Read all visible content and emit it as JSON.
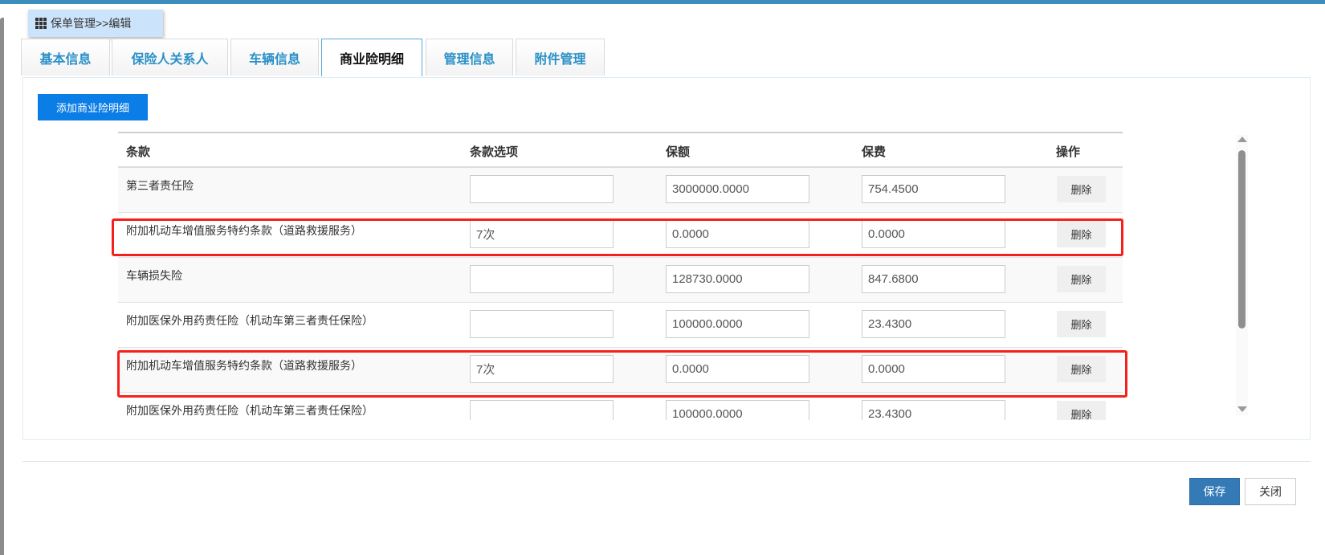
{
  "breadcrumb": {
    "icon": "grid-icon",
    "text": "保单管理>>编辑"
  },
  "tabs": [
    {
      "label": "基本信息"
    },
    {
      "label": "保险人关系人"
    },
    {
      "label": "车辆信息"
    },
    {
      "label": "商业险明细",
      "active": true
    },
    {
      "label": "管理信息"
    },
    {
      "label": "附件管理"
    }
  ],
  "add_button": "添加商业险明细",
  "table": {
    "headers": [
      "条款",
      "条款选项",
      "保额",
      "保费",
      "操作"
    ],
    "rows": [
      {
        "name": "第三者责任险",
        "option": "",
        "amount": "3000000.0000",
        "premium": "754.4500",
        "action": "删除",
        "highlighted": false
      },
      {
        "name": "附加机动车增值服务特约条款（道路救援服务）",
        "option": "7次",
        "amount": "0.0000",
        "premium": "0.0000",
        "action": "删除",
        "highlighted": true
      },
      {
        "name": "车辆损失险",
        "option": "",
        "amount": "128730.0000",
        "premium": "847.6800",
        "action": "删除",
        "highlighted": false
      },
      {
        "name": "附加医保外用药责任险（机动车第三者责任保险）",
        "option": "",
        "amount": "100000.0000",
        "premium": "23.4300",
        "action": "删除",
        "highlighted": false
      },
      {
        "name": "附加机动车增值服务特约条款（道路救援服务）",
        "option": "7次",
        "amount": "0.0000",
        "premium": "0.0000",
        "action": "删除",
        "highlighted": true
      },
      {
        "name": "附加医保外用药责任险（机动车第三者责任保险）",
        "option": "",
        "amount": "100000.0000",
        "premium": "23.4300",
        "action": "删除",
        "highlighted": false
      }
    ]
  },
  "footer": {
    "save": "保存",
    "close": "关闭"
  },
  "colors": {
    "accent": "#0b7de6",
    "tab_text": "#2a90c6",
    "highlight": "#f5201a",
    "save": "#337ab7"
  }
}
